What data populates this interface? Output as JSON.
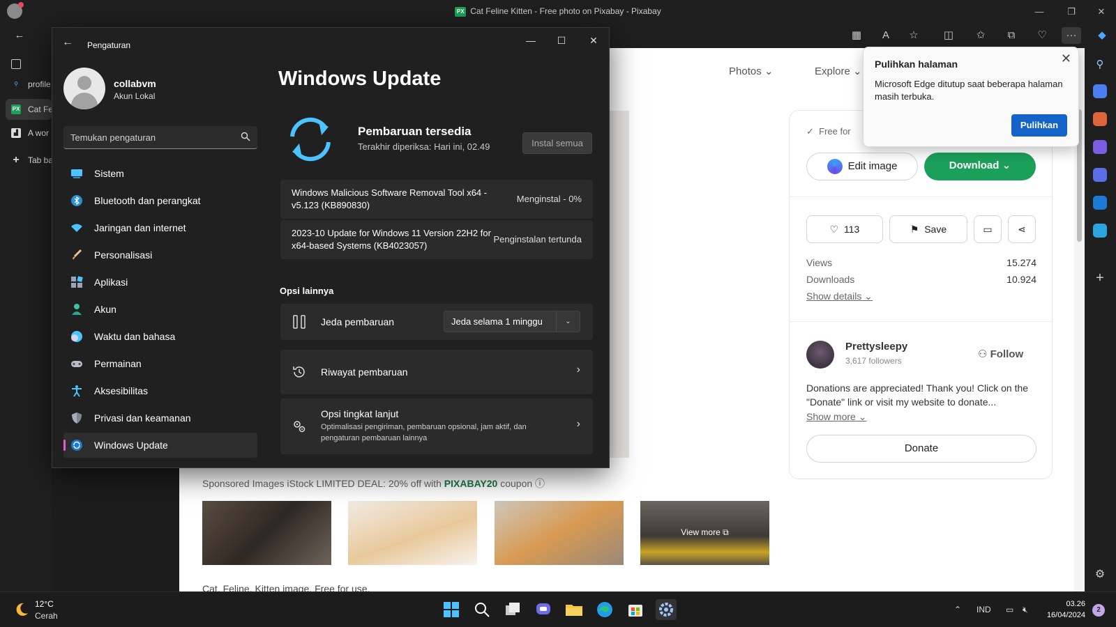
{
  "browser": {
    "window_title": "Cat Feline Kitten - Free photo on Pixabay - Pixabay",
    "tab_favicon": "PX",
    "tabs": [
      {
        "label": "profile"
      },
      {
        "label": "Cat Fe"
      },
      {
        "label": "A wor"
      },
      {
        "label": "Tab ba"
      }
    ]
  },
  "pixabay": {
    "nav": {
      "photos": "Photos",
      "explore": "Explore"
    },
    "free_label": "Free for",
    "edit_label": "Edit image",
    "download_label": "Download",
    "likes": "113",
    "save_label": "Save",
    "stats": [
      {
        "label": "Views",
        "value": "15.274"
      },
      {
        "label": "Downloads",
        "value": "10.924"
      }
    ],
    "show_details": "Show details",
    "author": {
      "name": "Prettysleepy",
      "followers": "3,617 followers",
      "follow": "Follow"
    },
    "description": "Donations are appreciated! Thank you! Click on the \"Donate\" link or visit my website to donate...",
    "show_more": "Show more",
    "donate": "Donate",
    "sponsored": {
      "prefix": "Sponsored Images iStock LIMITED DEAL: 20% off with",
      "code": "PIXABAY20",
      "suffix": "coupon"
    },
    "view_more": "View more",
    "footer": "Cat, Feline, Kitten image. Free for use."
  },
  "restore_popup": {
    "title": "Pulihkan halaman",
    "body": "Microsoft Edge ditutup saat beberapa halaman masih terbuka.",
    "button": "Pulihkan"
  },
  "settings": {
    "app_title": "Pengaturan",
    "user": {
      "name": "collabvm",
      "type": "Akun Lokal"
    },
    "search_placeholder": "Temukan pengaturan",
    "nav": [
      {
        "label": "Sistem",
        "icon": "system-icon"
      },
      {
        "label": "Bluetooth dan perangkat",
        "icon": "bluetooth-icon"
      },
      {
        "label": "Jaringan dan internet",
        "icon": "wifi-icon"
      },
      {
        "label": "Personalisasi",
        "icon": "brush-icon"
      },
      {
        "label": "Aplikasi",
        "icon": "apps-icon"
      },
      {
        "label": "Akun",
        "icon": "account-icon"
      },
      {
        "label": "Waktu dan bahasa",
        "icon": "time-language-icon"
      },
      {
        "label": "Permainan",
        "icon": "gaming-icon"
      },
      {
        "label": "Aksesibilitas",
        "icon": "accessibility-icon"
      },
      {
        "label": "Privasi dan keamanan",
        "icon": "shield-icon"
      },
      {
        "label": "Windows Update",
        "icon": "windows-update-icon"
      }
    ],
    "page_title": "Windows Update",
    "status_title": "Pembaruan tersedia",
    "status_sub": "Terakhir diperiksa: Hari ini, 02.49",
    "install_all": "Instal semua",
    "updates": [
      {
        "name": "Windows Malicious Software Removal Tool x64 - v5.123 (KB890830)",
        "status": "Menginstal - 0%"
      },
      {
        "name": "2023-10 Update for Windows 11 Version 22H2 for x64-based Systems (KB4023057)",
        "status": "Penginstalan tertunda"
      }
    ],
    "more_options": "Opsi lainnya",
    "pause": {
      "label": "Jeda pembaruan",
      "value": "Jeda selama 1 minggu"
    },
    "history": {
      "label": "Riwayat pembaruan"
    },
    "advanced": {
      "label": "Opsi tingkat lanjut",
      "sub": "Optimalisasi pengiriman, pembaruan opsional, jam aktif, dan pengaturan pembaruan lainnya"
    }
  },
  "taskbar": {
    "temp": "12°C",
    "weather": "Cerah",
    "lang": "IND",
    "time": "03.26",
    "date": "16/04/2024",
    "notifications": "2"
  },
  "colors": {
    "accent": "#4cc2ff",
    "pixabay_green": "#1ba05a",
    "edge_blue": "#1363c8"
  }
}
